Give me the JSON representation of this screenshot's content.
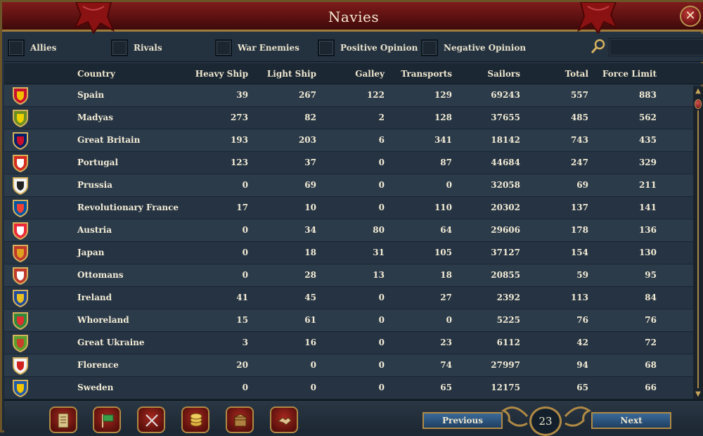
{
  "window": {
    "title": "Navies",
    "close_label": "✕"
  },
  "filters": [
    {
      "label": "Allies"
    },
    {
      "label": "Rivals"
    },
    {
      "label": "War Enemies"
    },
    {
      "label": "Positive Opinion"
    },
    {
      "label": "Negative Opinion"
    }
  ],
  "search": {
    "value": ""
  },
  "columns": [
    "Country",
    "Heavy Ship",
    "Light Ship",
    "Galley",
    "Transports",
    "Sailors",
    "Total",
    "Force Limit"
  ],
  "rows": [
    {
      "country": "Spain",
      "heavy": "39",
      "light": "267",
      "galley": "122",
      "transports": "129",
      "sailors": "69243",
      "total": "557",
      "force_limit": "883"
    },
    {
      "country": "Madyas",
      "heavy": "273",
      "light": "82",
      "galley": "2",
      "transports": "128",
      "sailors": "37655",
      "total": "485",
      "force_limit": "562"
    },
    {
      "country": "Great Britain",
      "heavy": "193",
      "light": "203",
      "galley": "6",
      "transports": "341",
      "sailors": "18142",
      "total": "743",
      "force_limit": "435"
    },
    {
      "country": "Portugal",
      "heavy": "123",
      "light": "37",
      "galley": "0",
      "transports": "87",
      "sailors": "44684",
      "total": "247",
      "force_limit": "329"
    },
    {
      "country": "Prussia",
      "heavy": "0",
      "light": "69",
      "galley": "0",
      "transports": "0",
      "sailors": "32058",
      "total": "69",
      "force_limit": "211"
    },
    {
      "country": "Revolutionary France",
      "heavy": "17",
      "light": "10",
      "galley": "0",
      "transports": "110",
      "sailors": "20302",
      "total": "137",
      "force_limit": "141"
    },
    {
      "country": "Austria",
      "heavy": "0",
      "light": "34",
      "galley": "80",
      "transports": "64",
      "sailors": "29606",
      "total": "178",
      "force_limit": "136"
    },
    {
      "country": "Japan",
      "heavy": "0",
      "light": "18",
      "galley": "31",
      "transports": "105",
      "sailors": "37127",
      "total": "154",
      "force_limit": "130"
    },
    {
      "country": "Ottomans",
      "heavy": "0",
      "light": "28",
      "galley": "13",
      "transports": "18",
      "sailors": "20855",
      "total": "59",
      "force_limit": "95"
    },
    {
      "country": "Ireland",
      "heavy": "41",
      "light": "45",
      "galley": "0",
      "transports": "27",
      "sailors": "2392",
      "total": "113",
      "force_limit": "84"
    },
    {
      "country": "Whoreland",
      "heavy": "15",
      "light": "61",
      "galley": "0",
      "transports": "0",
      "sailors": "5225",
      "total": "76",
      "force_limit": "76"
    },
    {
      "country": "Great Ukraine",
      "heavy": "3",
      "light": "16",
      "galley": "0",
      "transports": "23",
      "sailors": "6112",
      "total": "42",
      "force_limit": "72"
    },
    {
      "country": "Florence",
      "heavy": "20",
      "light": "0",
      "galley": "0",
      "transports": "74",
      "sailors": "27997",
      "total": "94",
      "force_limit": "68"
    },
    {
      "country": "Sweden",
      "heavy": "0",
      "light": "0",
      "galley": "0",
      "transports": "65",
      "sailors": "12175",
      "total": "65",
      "force_limit": "66"
    }
  ],
  "flags": [
    {
      "colors": [
        "#c8102e",
        "#f1bf00"
      ]
    },
    {
      "colors": [
        "#6b8e23",
        "#f0d000"
      ]
    },
    {
      "colors": [
        "#012169",
        "#c8102e"
      ]
    },
    {
      "colors": [
        "#d52b1e",
        "#ffffff"
      ]
    },
    {
      "colors": [
        "#f4f4f4",
        "#222222"
      ]
    },
    {
      "colors": [
        "#0055a4",
        "#ef4135"
      ]
    },
    {
      "colors": [
        "#ed2939",
        "#ffffff"
      ]
    },
    {
      "colors": [
        "#c0392b",
        "#e0a020"
      ]
    },
    {
      "colors": [
        "#c0392b",
        "#ffffff"
      ]
    },
    {
      "colors": [
        "#1e4a9e",
        "#e8c020"
      ]
    },
    {
      "colors": [
        "#2e8b3a",
        "#e03030"
      ]
    },
    {
      "colors": [
        "#5aa02c",
        "#c8402c"
      ]
    },
    {
      "colors": [
        "#f5f5f5",
        "#d02020"
      ]
    },
    {
      "colors": [
        "#1f5aa8",
        "#f2c500"
      ]
    }
  ],
  "bottom_bar": {
    "previous_label": "Previous",
    "next_label": "Next",
    "page_number": "23",
    "tool_buttons": [
      "ledger-icon",
      "flag-icon",
      "crossed-swords-icon",
      "coins-icon",
      "trade-goods-icon",
      "handshake-icon"
    ]
  },
  "colors": {
    "title_bar": "#6a1414",
    "gold_trim": "#b08a44",
    "row_odd": "#2c3b4a",
    "row_even": "#253342"
  }
}
